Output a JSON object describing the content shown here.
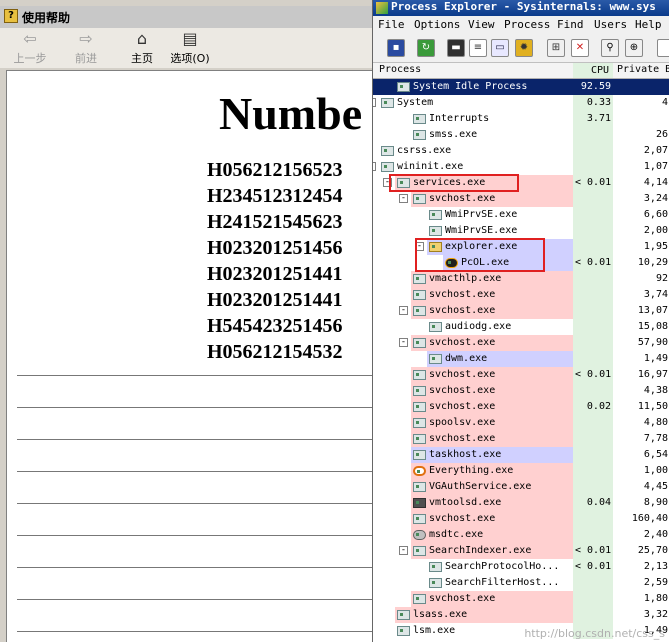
{
  "help_window": {
    "title": "使用帮助",
    "toolbar": [
      {
        "label": "上一步",
        "icon": "back-arrow-icon",
        "enabled": false
      },
      {
        "label": "前进",
        "icon": "forward-arrow-icon",
        "enabled": false
      },
      {
        "label": "主页",
        "icon": "home-icon",
        "enabled": true
      },
      {
        "label": "选项(O)",
        "icon": "options-icon",
        "enabled": true
      }
    ],
    "doc_title": "Numbe",
    "code_lines": [
      "H056212156523",
      "H234512312454",
      "H241521545623",
      "H023201251456",
      "H023201251441",
      "H023201251441",
      "H545423251456",
      "H056212154532"
    ]
  },
  "process_explorer": {
    "title": "Process Explorer - Sysinternals: www.sys",
    "menu": [
      "File",
      "Options",
      "View",
      "Process",
      "Find",
      "Users",
      "Help"
    ],
    "columns": {
      "process": "Process",
      "cpu": "CPU",
      "private_bytes": "Private B"
    },
    "rows": [
      {
        "name": "System Idle Process",
        "cpu": "92.59",
        "pb": "",
        "level": 1,
        "hl": "selected"
      },
      {
        "name": "System",
        "cpu": "0.33",
        "pb": "4",
        "level": 0,
        "expander": "-"
      },
      {
        "name": "Interrupts",
        "cpu": "3.71",
        "pb": "",
        "level": 2
      },
      {
        "name": "smss.exe",
        "cpu": "",
        "pb": "26",
        "level": 2
      },
      {
        "name": "csrss.exe",
        "cpu": "",
        "pb": "2,07",
        "level": 0
      },
      {
        "name": "wininit.exe",
        "cpu": "",
        "pb": "1,07",
        "level": 0,
        "expander": "-"
      },
      {
        "name": "services.exe",
        "cpu": "< 0.01",
        "pb": "4,14",
        "level": 1,
        "expander": "-",
        "hl": "pink"
      },
      {
        "name": "svchost.exe",
        "cpu": "",
        "pb": "3,24",
        "level": 2,
        "expander": "-",
        "hl": "pink"
      },
      {
        "name": "WmiPrvSE.exe",
        "cpu": "",
        "pb": "6,60",
        "level": 3
      },
      {
        "name": "WmiPrvSE.exe",
        "cpu": "",
        "pb": "2,00",
        "level": 3
      },
      {
        "name": "explorer.exe",
        "cpu": "",
        "pb": "1,95",
        "level": 3,
        "expander": "-",
        "hl": "blue",
        "icon": "folder"
      },
      {
        "name": "PcOL.exe",
        "cpu": "< 0.01",
        "pb": "10,29",
        "level": 4,
        "hl": "blue",
        "icon": "penguin"
      },
      {
        "name": "vmacthlp.exe",
        "cpu": "",
        "pb": "92",
        "level": 2,
        "hl": "pink"
      },
      {
        "name": "svchost.exe",
        "cpu": "",
        "pb": "3,74",
        "level": 2,
        "hl": "pink"
      },
      {
        "name": "svchost.exe",
        "cpu": "",
        "pb": "13,07",
        "level": 2,
        "expander": "-",
        "hl": "pink"
      },
      {
        "name": "audiodg.exe",
        "cpu": "",
        "pb": "15,08",
        "level": 3
      },
      {
        "name": "svchost.exe",
        "cpu": "",
        "pb": "57,90",
        "level": 2,
        "expander": "-",
        "hl": "pink"
      },
      {
        "name": "dwm.exe",
        "cpu": "",
        "pb": "1,49",
        "level": 3,
        "hl": "blue"
      },
      {
        "name": "svchost.exe",
        "cpu": "< 0.01",
        "pb": "16,97",
        "level": 2,
        "hl": "pink"
      },
      {
        "name": "svchost.exe",
        "cpu": "",
        "pb": "4,38",
        "level": 2,
        "hl": "pink"
      },
      {
        "name": "svchost.exe",
        "cpu": "0.02",
        "pb": "11,50",
        "level": 2,
        "hl": "pink"
      },
      {
        "name": "spoolsv.exe",
        "cpu": "",
        "pb": "4,80",
        "level": 2,
        "hl": "pink"
      },
      {
        "name": "svchost.exe",
        "cpu": "",
        "pb": "7,78",
        "level": 2,
        "hl": "pink"
      },
      {
        "name": "taskhost.exe",
        "cpu": "",
        "pb": "6,54",
        "level": 2,
        "hl": "blue"
      },
      {
        "name": "Everything.exe",
        "cpu": "",
        "pb": "1,00",
        "level": 2,
        "hl": "pink",
        "icon": "magnifier"
      },
      {
        "name": "VGAuthService.exe",
        "cpu": "",
        "pb": "4,45",
        "level": 2,
        "hl": "pink"
      },
      {
        "name": "vmtoolsd.exe",
        "cpu": "0.04",
        "pb": "8,90",
        "level": 2,
        "hl": "pink",
        "icon": "vm"
      },
      {
        "name": "svchost.exe",
        "cpu": "",
        "pb": "160,40",
        "level": 2,
        "hl": "pink"
      },
      {
        "name": "msdtc.exe",
        "cpu": "",
        "pb": "2,40",
        "level": 2,
        "hl": "pink",
        "icon": "gear"
      },
      {
        "name": "SearchIndexer.exe",
        "cpu": "< 0.01",
        "pb": "25,70",
        "level": 2,
        "expander": "-",
        "hl": "pink"
      },
      {
        "name": "SearchProtocolHo...",
        "cpu": "< 0.01",
        "pb": "2,13",
        "level": 3
      },
      {
        "name": "SearchFilterHost...",
        "cpu": "",
        "pb": "2,59",
        "level": 3
      },
      {
        "name": "svchost.exe",
        "cpu": "",
        "pb": "1,80",
        "level": 2,
        "hl": "pink"
      },
      {
        "name": "lsass.exe",
        "cpu": "",
        "pb": "3,32",
        "level": 1,
        "hl": "pink"
      },
      {
        "name": "lsm.exe",
        "cpu": "",
        "pb": "1,49",
        "level": 1
      }
    ]
  },
  "watermark": "http://blog.csdn.net/css_s",
  "colors": {
    "pink_service": "#ffd0d0",
    "blue_user": "#d0d0ff",
    "cpu_column": "#e0f2e0",
    "selection": "#0a246a",
    "annotation_box": "#e02020"
  }
}
